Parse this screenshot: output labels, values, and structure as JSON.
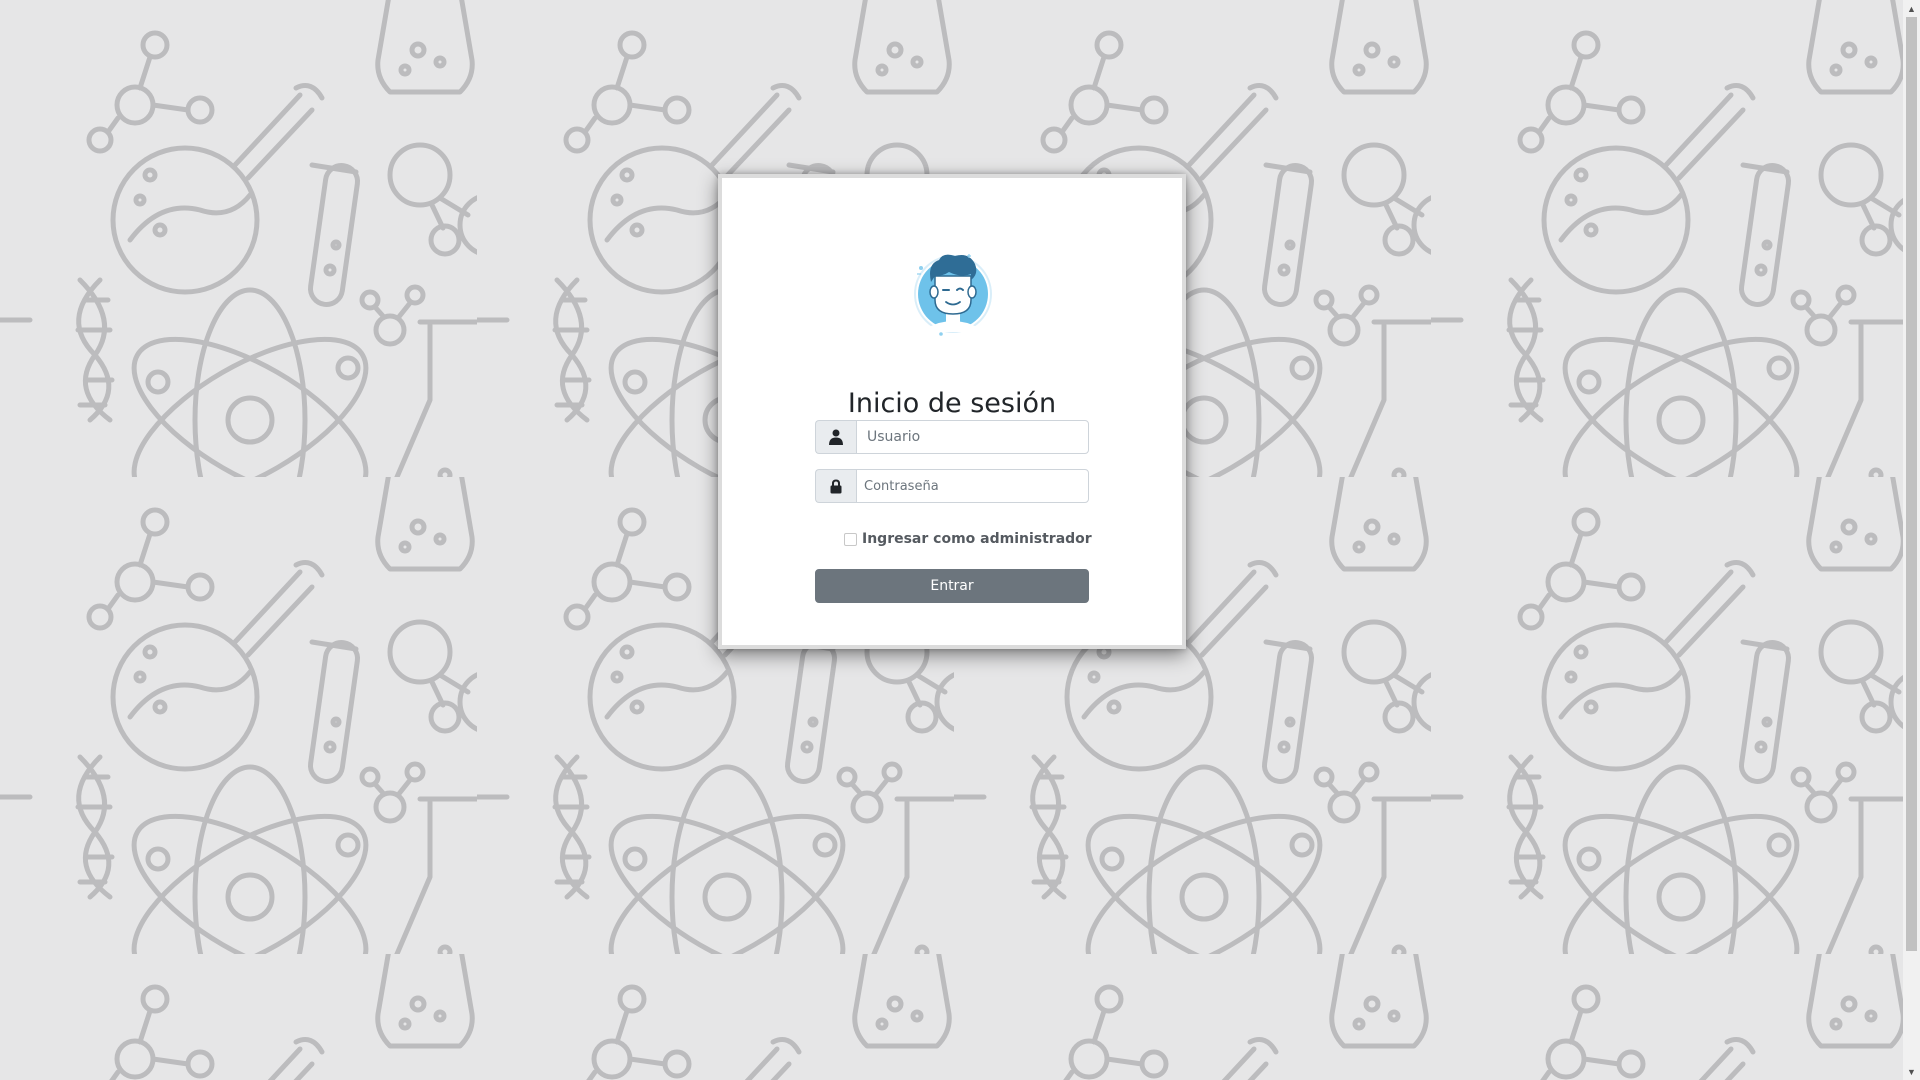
{
  "login": {
    "title": "Inicio de sesión",
    "username": {
      "placeholder": "Usuario",
      "value": ""
    },
    "password": {
      "placeholder": "Contraseña",
      "value": ""
    },
    "admin_checkbox": {
      "label": "Ingresar como administrador",
      "checked": false
    },
    "submit_label": "Entrar"
  },
  "icons": {
    "username_addon": "user-icon",
    "password_addon": "lock-icon",
    "avatar": "avatar-icon",
    "scroll_up": "chevron-up-icon",
    "scroll_down": "chevron-down-icon"
  },
  "colors": {
    "background": "#e6e6e7",
    "pattern_stroke": "#bcbcbe",
    "button": "#6c757d",
    "avatar_face": "#6ec2ea"
  }
}
